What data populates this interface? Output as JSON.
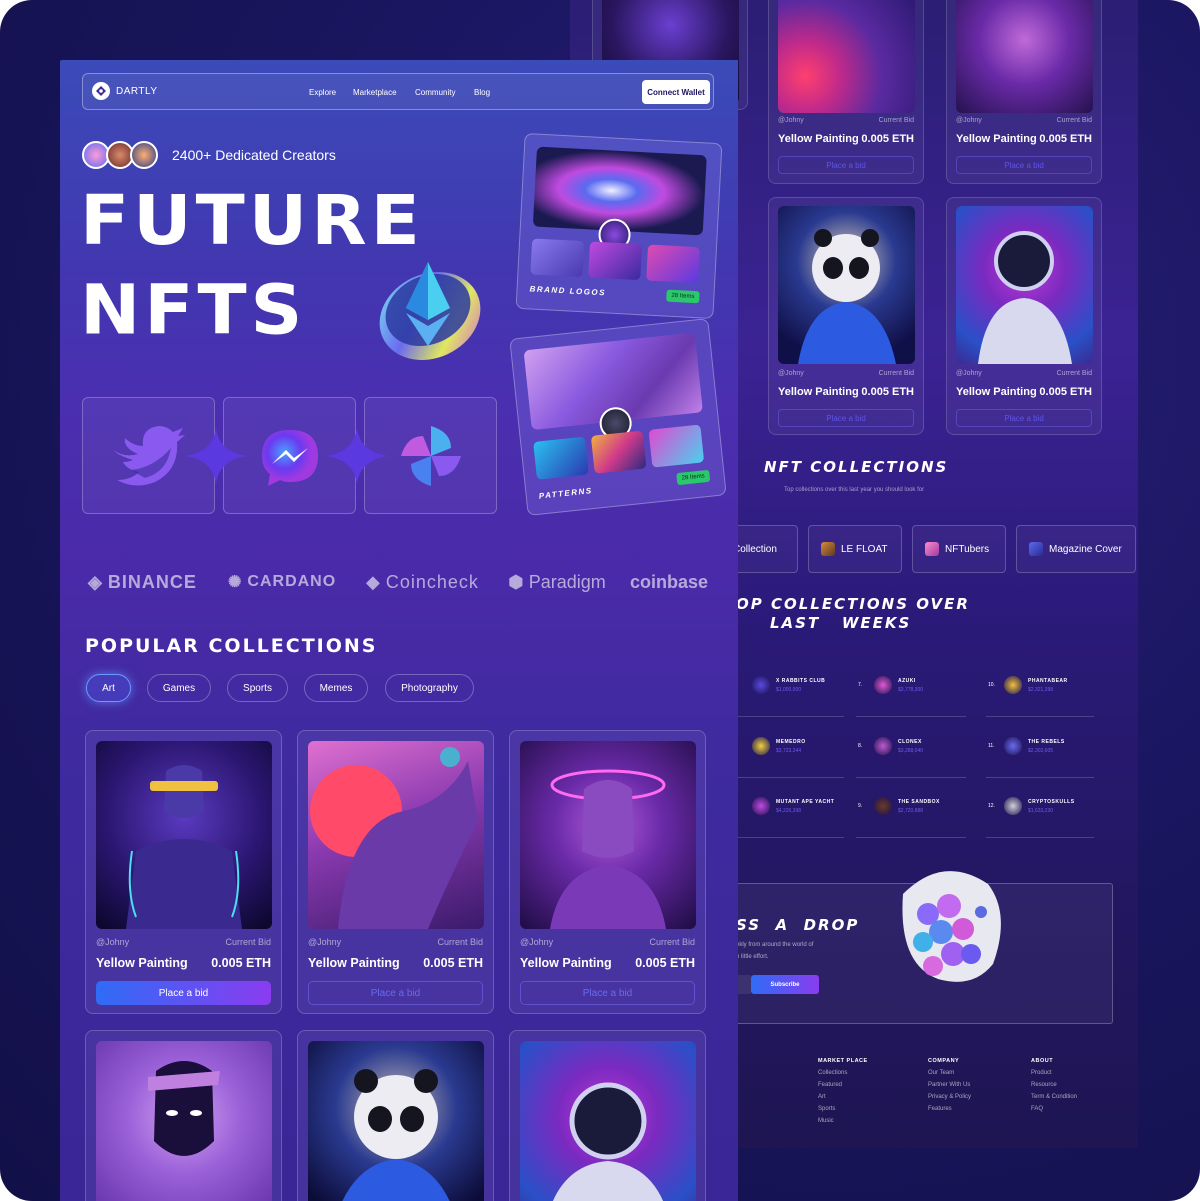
{
  "brand": {
    "name": "DARTLY"
  },
  "nav": {
    "links": [
      "Explore",
      "Marketplace",
      "Community",
      "Blog"
    ],
    "connect_label": "Connect Wallet"
  },
  "hero": {
    "creators": "2400+ Dedicated Creators",
    "title_line1": "FUTURE",
    "title_line2": "NFTS"
  },
  "showcase": [
    {
      "label": "BRAND LOGOS",
      "count": "28 Items"
    },
    {
      "label": "PATTERNS",
      "count": "28 Items"
    }
  ],
  "partners": [
    "BINANCE",
    "CARDANO",
    "Coincheck",
    "Paradigm",
    "coinbase"
  ],
  "popular": {
    "heading": "POPULAR COLLECTIONS",
    "filters": [
      "Art",
      "Games",
      "Sports",
      "Memes",
      "Photography"
    ],
    "active_filter": "Art"
  },
  "card": {
    "author": "@Johny",
    "bid_label": "Current Bid",
    "name": "Yellow Painting",
    "price": "0.005 ETH",
    "button": "Place a bid"
  },
  "collections_section": {
    "heading": "NFT COLLECTIONS",
    "subtitle": "Top collections over this last year you should look for",
    "chips": [
      "Collection",
      "LE FLOAT",
      "NFTubers",
      "Magazine Cover"
    ]
  },
  "top_section": {
    "heading_line1": "OP COLLECTIONS OVER",
    "heading_line2": "LAST   WEEKS",
    "rows": [
      [
        {
          "num": "",
          "name": "X RABBITS CLUB",
          "value": "$1,000,000"
        },
        {
          "num": "7.",
          "name": "AZUKI",
          "value": "$3,778,300"
        },
        {
          "num": "10.",
          "name": "PHANTABEAR",
          "value": "$2,321,398"
        }
      ],
      [
        {
          "num": "",
          "name": "MEMEDRO",
          "value": "$3,723,244"
        },
        {
          "num": "8.",
          "name": "CLONEX",
          "value": "$3,288,040"
        },
        {
          "num": "11.",
          "name": "THE REBELS",
          "value": "$2,302,605"
        }
      ],
      [
        {
          "num": "",
          "name": "MUTANT APE YACHT",
          "value": "$4,226,398"
        },
        {
          "num": "9.",
          "name": "THE SANDBOX",
          "value": "$2,720,888"
        },
        {
          "num": "12.",
          "name": "CRYPTOSKULLS",
          "value": "$1,633,230"
        }
      ]
    ]
  },
  "drop": {
    "heading": "SS  A  DROP",
    "text1": "ekly from around the world of",
    "text2": "n little effort.",
    "button": "Subscribe"
  },
  "footer": {
    "columns": [
      {
        "title": "MARKET PLACE",
        "items": [
          "Collections",
          "Featured",
          "Art",
          "Sports",
          "Music"
        ]
      },
      {
        "title": "COMPANY",
        "items": [
          "Our Team",
          "Partner With Us",
          "Privacy & Policy",
          "Features"
        ]
      },
      {
        "title": "ABOUT",
        "items": [
          "Product",
          "Resource",
          "Term & Condition",
          "FAQ"
        ]
      }
    ]
  },
  "colors": {
    "accent": "#6c5cf0",
    "button_gradient_start": "#2f6cf5",
    "button_gradient_end": "#8a3cf0"
  }
}
